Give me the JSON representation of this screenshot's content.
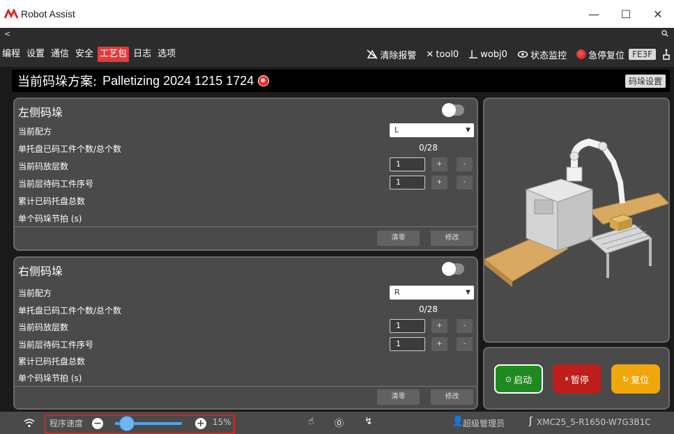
{
  "app": {
    "title": "Robot Assist"
  },
  "window_controls": {
    "minimize": "—",
    "maximize": "☐",
    "close": "✕"
  },
  "strip": {
    "back": "<",
    "search": "🔍"
  },
  "menu": [
    "编程",
    "设置",
    "通信",
    "安全",
    "工艺包",
    "日志",
    "选项"
  ],
  "menu_active": "工艺包",
  "tools": {
    "clear_alarm": "清除报警",
    "tool": "tool0",
    "wobj": "wobj0",
    "status_monitor": "状态监控",
    "estop_reset": "急停复位",
    "code": "FE3F"
  },
  "plan": {
    "label": "当前码垛方案:",
    "name": "Palletizing 2024 1215 1724",
    "settings": "码垛设置"
  },
  "left_panel": {
    "title": "左侧码垛",
    "recipe_label": "当前配方",
    "recipe_value": "L",
    "pallet_count_label": "单托盘已码工件个数/总个数",
    "pallet_count_value": "0/28",
    "layer_label": "当前码放层数",
    "layer_value": "1",
    "seq_label": "当前层待码工件序号",
    "seq_value": "1",
    "total_label": "累计已码托盘总数",
    "cycle_label": "单个码垛节拍 (s)",
    "clear": "清零",
    "modify": "修改",
    "plus": "+",
    "minus": "-"
  },
  "right_panel": {
    "title": "右侧码垛",
    "recipe_label": "当前配方",
    "recipe_value": "R",
    "pallet_count_label": "单托盘已码工件个数/总个数",
    "pallet_count_value": "0/28",
    "layer_label": "当前码放层数",
    "layer_value": "1",
    "seq_label": "当前层待码工件序号",
    "seq_value": "1",
    "total_label": "累计已码托盘总数",
    "cycle_label": "单个码垛节拍 (s)",
    "clear": "清零",
    "modify": "修改",
    "plus": "+",
    "minus": "-"
  },
  "controls": {
    "start": "启动",
    "pause": "暂停",
    "reset": "复位"
  },
  "status": {
    "speed_label": "程序速度",
    "speed_value": "15%",
    "speed_fraction": 0.15,
    "user": "超级管理员",
    "device": "XMC25_5-R1650-W7G3B1C"
  },
  "colors": {
    "accent_menu": "#e43a3a",
    "start": "#1f8a1f",
    "pause": "#c01d1d",
    "reset": "#f0a70c",
    "slider": "#5aa3e6",
    "highlight_box": "#e02020"
  }
}
